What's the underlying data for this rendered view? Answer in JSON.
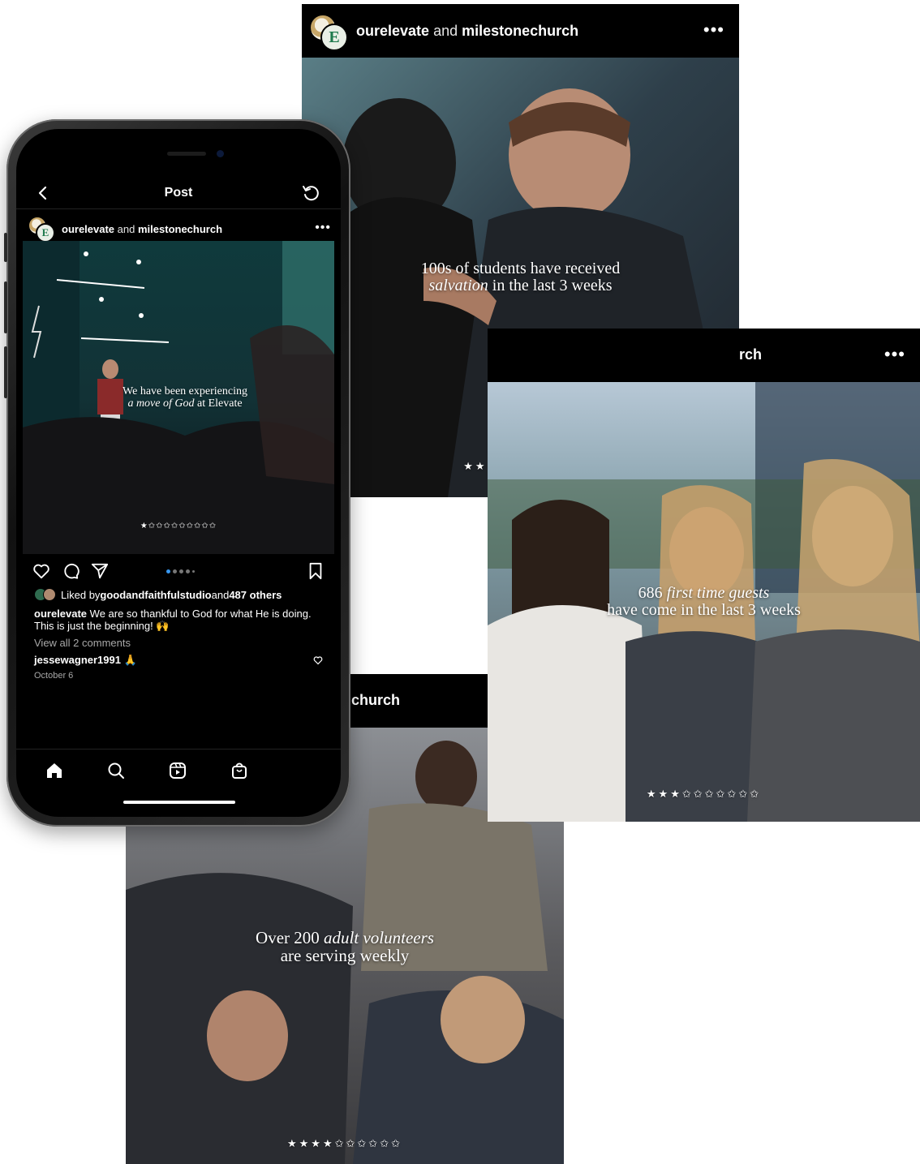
{
  "post_account": {
    "primary": "ourelevate",
    "joiner": "and",
    "collab": "milestonechurch",
    "collab_partial_church": "church",
    "collab_partial_rch": "rch"
  },
  "card_top": {
    "line1": "100s of students have received",
    "line2_italic": "salvation",
    "line2_rest": " in the last 3 weeks",
    "stars": "★★✩✩✩✩✩✩✩✩"
  },
  "card_right": {
    "line1_num": "686 ",
    "line1_italic": "first time guests",
    "line2": "have come in the last 3 weeks",
    "stars": "★★★✩✩✩✩✩✩✩"
  },
  "card_bottom": {
    "line1_pre": "Over 200 ",
    "line1_italic": "adult volunteers",
    "line2": "are serving weekly",
    "stars": "★★★★✩✩✩✩✩✩"
  },
  "phone": {
    "nav_title": "Post",
    "slide_text_1": "We have been experiencing",
    "slide_text_2_italic": "a move of God",
    "slide_text_2_rest": " at Elevate",
    "slide_stars": "★✩✩✩✩✩✩✩✩✩",
    "likes_prefix": "Liked by ",
    "likes_user": "goodandfaithfulstudio",
    "likes_and": " and ",
    "likes_others": "487 others",
    "caption_user": "ourelevate",
    "caption_text": " We are so thankful to God for what He is doing. This is just the beginning! 🙌",
    "view_all": "View all 2 comments",
    "comment_user": "jessewagner1991",
    "comment_text": " 🙏",
    "date": "October 6"
  },
  "icons": {
    "more": "more-icon",
    "back": "chevron-left-icon",
    "refresh": "refresh-icon",
    "like": "heart-icon",
    "comment": "comment-icon",
    "share": "paper-plane-icon",
    "save": "bookmark-icon",
    "home": "home-icon",
    "search": "search-icon",
    "reels": "reels-icon",
    "shop": "shop-icon"
  },
  "colors": {
    "brand_green": "#1f7a4d",
    "active_dot": "#3897f0",
    "header_bg": "#000000"
  }
}
